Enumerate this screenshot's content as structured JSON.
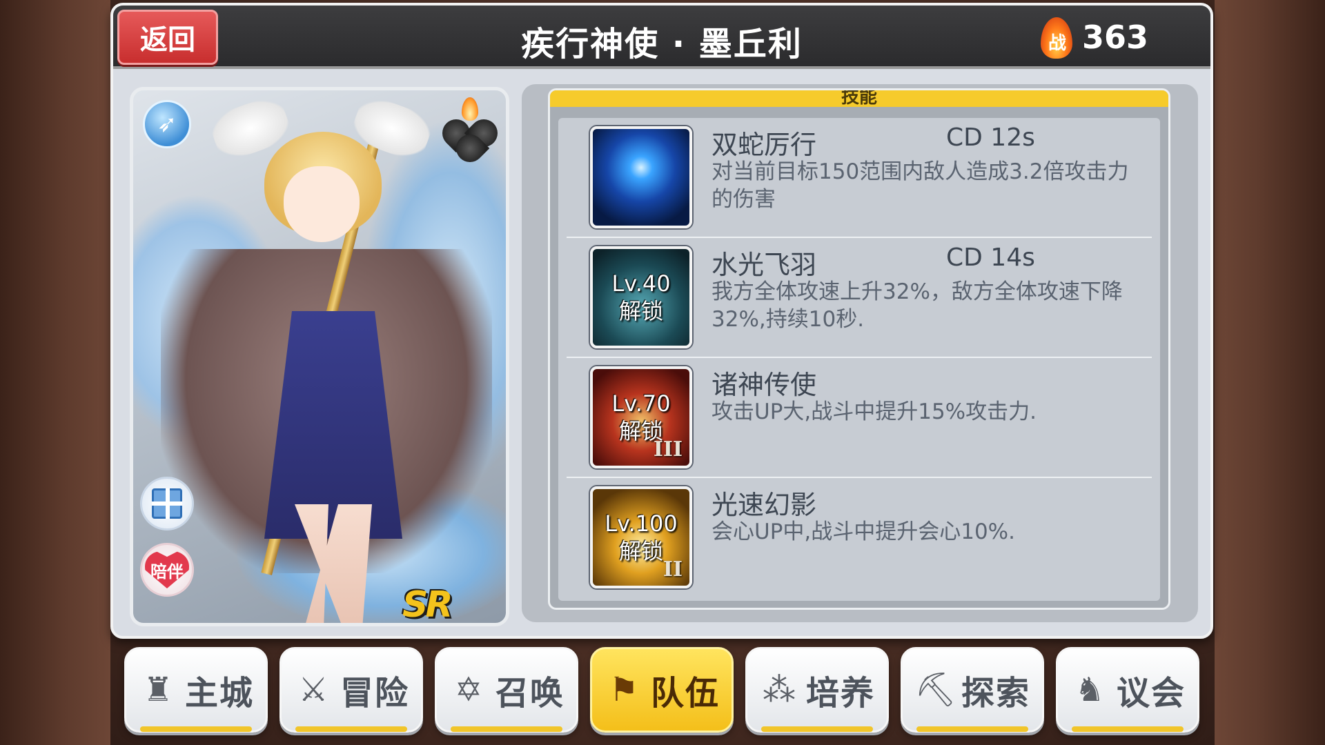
{
  "header": {
    "back_label": "返回",
    "title": "疾行神使 · 墨丘利",
    "power_badge": "战",
    "power_value": "363"
  },
  "card": {
    "class_icon": "bow-icon",
    "element_icon": "fire-element-icon",
    "gift_icon": "gift-icon",
    "accompany_label": "陪伴",
    "rarity": "SR"
  },
  "skills": {
    "header": "技能",
    "items": [
      {
        "name": "双蛇厉行",
        "cd": "CD  12s",
        "desc": "对当前目标150范围内敌人造成3.2倍攻击力的伤害",
        "lock": "",
        "roman": ""
      },
      {
        "name": "水光飞羽",
        "cd": "CD  14s",
        "desc": "我方全体攻速上升32%，敌方全体攻速下降32%,持续10秒.",
        "lock": "Lv.40\n解锁",
        "roman": ""
      },
      {
        "name": "诸神传使",
        "cd": "",
        "desc": "攻击UP大,战斗中提升15%攻击力.",
        "lock": "Lv.70\n解锁",
        "roman": "III"
      },
      {
        "name": "光速幻影",
        "cd": "",
        "desc": "会心UP中,战斗中提升会心10%.",
        "lock": "Lv.100\n解锁",
        "roman": "II"
      }
    ]
  },
  "nav": {
    "items": [
      {
        "label": "主城",
        "icon": "castle-icon"
      },
      {
        "label": "冒险",
        "icon": "crossed-swords-icon"
      },
      {
        "label": "召唤",
        "icon": "summon-circle-icon"
      },
      {
        "label": "队伍",
        "icon": "team-icon"
      },
      {
        "label": "培养",
        "icon": "train-icon"
      },
      {
        "label": "探索",
        "icon": "explore-icon"
      },
      {
        "label": "议会",
        "icon": "council-icon"
      }
    ],
    "active_index": 3
  }
}
